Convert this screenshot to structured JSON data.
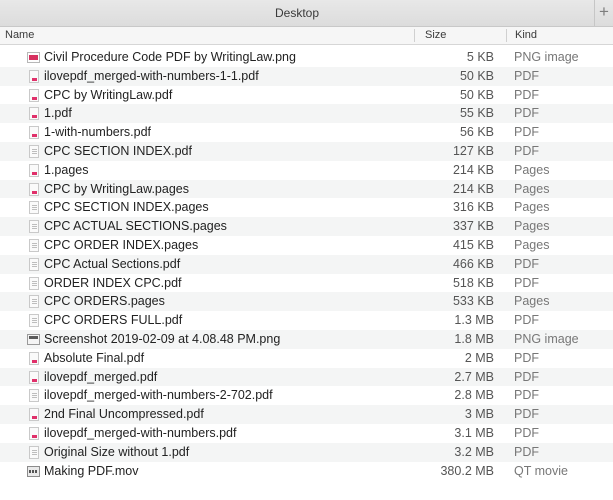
{
  "window": {
    "title": "Desktop",
    "new_tab_symbol": "+"
  },
  "columns": {
    "name": "Name",
    "size": "Size",
    "kind": "Kind"
  },
  "files": [
    {
      "name": "Civil Procedure Code PDF by WritingLaw.png",
      "size": "5 KB",
      "kind": "PNG image",
      "icon": "png"
    },
    {
      "name": "ilovepdf_merged-with-numbers-1-1.pdf",
      "size": "50 KB",
      "kind": "PDF",
      "icon": "pdf"
    },
    {
      "name": "CPC by WritingLaw.pdf",
      "size": "50 KB",
      "kind": "PDF",
      "icon": "pdf"
    },
    {
      "name": "1.pdf",
      "size": "55 KB",
      "kind": "PDF",
      "icon": "pdf"
    },
    {
      "name": "1-with-numbers.pdf",
      "size": "56 KB",
      "kind": "PDF",
      "icon": "pdf"
    },
    {
      "name": "CPC SECTION INDEX.pdf",
      "size": "127 KB",
      "kind": "PDF",
      "icon": "doc"
    },
    {
      "name": "1.pages",
      "size": "214 KB",
      "kind": "Pages",
      "icon": "pdf"
    },
    {
      "name": "CPC by WritingLaw.pages",
      "size": "214 KB",
      "kind": "Pages",
      "icon": "pdf"
    },
    {
      "name": "CPC SECTION INDEX.pages",
      "size": "316 KB",
      "kind": "Pages",
      "icon": "doc"
    },
    {
      "name": "CPC ACTUAL SECTIONS.pages",
      "size": "337 KB",
      "kind": "Pages",
      "icon": "doc"
    },
    {
      "name": "CPC ORDER INDEX.pages",
      "size": "415 KB",
      "kind": "Pages",
      "icon": "doc"
    },
    {
      "name": "CPC Actual Sections.pdf",
      "size": "466 KB",
      "kind": "PDF",
      "icon": "doc"
    },
    {
      "name": "ORDER INDEX CPC.pdf",
      "size": "518 KB",
      "kind": "PDF",
      "icon": "doc"
    },
    {
      "name": "CPC ORDERS.pages",
      "size": "533 KB",
      "kind": "Pages",
      "icon": "doc"
    },
    {
      "name": "CPC ORDERS FULL.pdf",
      "size": "1.3 MB",
      "kind": "PDF",
      "icon": "doc"
    },
    {
      "name": "Screenshot 2019-02-09 at 4.08.48 PM.png",
      "size": "1.8 MB",
      "kind": "PNG image",
      "icon": "shot"
    },
    {
      "name": "Absolute Final.pdf",
      "size": "2 MB",
      "kind": "PDF",
      "icon": "pdf"
    },
    {
      "name": "ilovepdf_merged.pdf",
      "size": "2.7 MB",
      "kind": "PDF",
      "icon": "pdf"
    },
    {
      "name": "ilovepdf_merged-with-numbers-2-702.pdf",
      "size": "2.8 MB",
      "kind": "PDF",
      "icon": "doc"
    },
    {
      "name": "2nd Final Uncompressed.pdf",
      "size": "3 MB",
      "kind": "PDF",
      "icon": "pdf"
    },
    {
      "name": "ilovepdf_merged-with-numbers.pdf",
      "size": "3.1 MB",
      "kind": "PDF",
      "icon": "pdf"
    },
    {
      "name": "Original Size without 1.pdf",
      "size": "3.2 MB",
      "kind": "PDF",
      "icon": "doc"
    },
    {
      "name": "Making PDF.mov",
      "size": "380.2 MB",
      "kind": "QT movie",
      "icon": "mov"
    }
  ]
}
